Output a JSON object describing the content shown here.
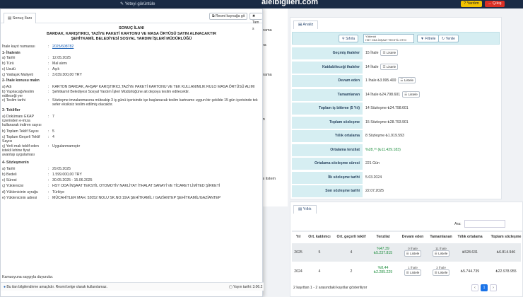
{
  "header": {
    "top_link": "Yeteyi görüntüle",
    "brand": "aleibiglieri.com",
    "help": "Yardım",
    "logout": "Çıkış"
  },
  "sidebar": {
    "items": [
      "",
      "arama",
      "ma",
      "",
      "arama",
      "",
      "",
      "im",
      "",
      "",
      "",
      "lis listem",
      "r"
    ]
  },
  "modal": {
    "tab": "Sonuç İlanı",
    "btn_source": "Resmi kaynağa git",
    "btn_other": "Tam s",
    "title_lines": [
      "SONUÇ İLANI",
      "BARDAK, KARIŞTIRICI, TAZİYE PAKETİ KARTONU VE MASA ÖRTÜSÜ SATIN ALINACAKTIR",
      "ŞEHİTKAMİL BELEDİYESİ SOSYAL YARDIM İŞLERİ MÜDÜRLÜĞÜ"
    ],
    "rows": [
      {
        "k": "İhale kayıt numarası",
        "v": "2025/608782",
        "link": true
      },
      {
        "k": "1- İhalenin",
        "sec": true
      },
      {
        "k": "a) Tarihi",
        "v": "12.05.2025"
      },
      {
        "k": "b) Türü",
        "v": "Mal alımı"
      },
      {
        "k": "c) Usulü",
        "v": "Açık"
      },
      {
        "k": "ç) Yaklaşık Maliyeti",
        "v": "3.039.300,00 TRY"
      },
      {
        "k": "2- İhale konusu malın",
        "sec": true
      },
      {
        "k": "a) Adı",
        "v": "KARTON BARDAK, AHŞAP KARIŞTIRICI,TAZİYE PAKETİ KARTONU VE TEK KULLANIMLIK RULO MASA ÖRTÜSÜ ALIMI"
      },
      {
        "k": "b) Yapılacağı/teslim edileceği yer",
        "v": "Şehitkamil Belediyesi Sosyal Yardım İşleri Müdürlüğüne ait depoya teslim edilecektir."
      },
      {
        "k": "c) Teslim tarihi",
        "v": "Sözleşme imzalanmasına müteakip 3 iş günü içerisinde işe başlanacak teslim kartname uygun bir şekilde 15 gün içerisinde tek sefer eksiksiz teslim edilmiş olacaktır."
      },
      {
        "k": "3- Teklifler",
        "sec": true
      },
      {
        "k": "a) Dokümanı EKAP üzerinden e-imza kullanarak indiren sayısı",
        "v": "7"
      },
      {
        "k": "b) Toplam Teklif Sayısı",
        "v": "5"
      },
      {
        "k": "c) Toplam Geçerli Teklif Sayısı",
        "v": "4"
      },
      {
        "k": "ç) Yerli malı teklif eden istekli lehine fiyat avantajı uygulaması",
        "v": "Uygulanmamıştır"
      },
      {
        "k": "4- Sözleşmenin",
        "sec": true
      },
      {
        "k": "a) Tarihi",
        "v": "29.05.2025"
      },
      {
        "k": "b) Bedeli",
        "v": "1.599.000,00 TRY"
      },
      {
        "k": "c) Süresi",
        "v": "30.05.2025 - 15.06.2025"
      },
      {
        "k": "ç) Yüklenicisi",
        "v": "HSY ODA İNŞAAT TEKSTİL OTOMOTİV NAKLİYAT İTHALAT SANAYİ VE TİCARET LİMİTED ŞİRKETİ"
      },
      {
        "k": "d) Yüklenicinin uyruğu",
        "v": "Türkiye"
      },
      {
        "k": "e) Yüklenicinin adresi",
        "v": "MÜCAHİTLER MAH. 52052 NOLU SK.NO:19/A ŞEHİTKAMİL / GAZİANTEP ŞEHİTKAMİL/GAZİANTEP"
      }
    ],
    "closing": "Kamuoyuna saygıyla duyurulur.",
    "footer_note": "Bu ilan bilgilendirme amaçlıdır. Resmi belge olarak kullanılamaz.",
    "footer_date": "Yayın tarihi: 3.06.2"
  },
  "analysis": {
    "tab": "Analiz",
    "btn_search": "Sıfırla",
    "tag_label": "Yüklenici",
    "tag_value": "HSY ODA İNŞAAT TEKSTİL OTOI",
    "btn_filter": "Filtrele",
    "btn_refresh": "Yenile",
    "list_label": "Listele",
    "stats": [
      {
        "label": "Geçmiş ihaleler",
        "value": "15 İhale",
        "btn": true
      },
      {
        "label": "Katılabileceği ihaleler",
        "value": "14 İhale",
        "btn": true
      },
      {
        "label": "Devam eden",
        "value": "1 İhale  ₺3.995.400",
        "btn": true
      },
      {
        "label": "Tamamlanan",
        "value": "14 İhale  ₺24.798.601",
        "btn": true
      },
      {
        "label": "Toplam iş bitirme (5 Yıl)",
        "value": "14 Sözleşme  ₺24.798.601",
        "btn": false
      },
      {
        "label": "Toplam sözleşme",
        "value": "15 Sözleşme  ₺28.793.901",
        "btn": false
      },
      {
        "label": "Yıllık ortalama",
        "value": "8 Sözleşme  ₺1.919.593",
        "btn": false
      },
      {
        "label": "Ortalama tenzilat",
        "value": "%28,⁵⁶  (₺11.429.183)",
        "btn": false,
        "green": true
      },
      {
        "label": "Ortalama sözleşme süresi",
        "value": "221 Gün",
        "btn": false
      },
      {
        "label": "İlk sözleşme tarihi",
        "value": "5.03.2024",
        "btn": false
      },
      {
        "label": "Son sözleşme tarihi",
        "value": "22.07.2025",
        "btn": false
      }
    ]
  },
  "yearly": {
    "tab": "Yıllık",
    "search_label": "Ara:",
    "columns": [
      "Yıl",
      "Ort. katılımcı",
      "Ort. geçerli teklif",
      "Tenzilat",
      "Devam eden",
      "Tamamlanan",
      "Yıllık ortalama",
      "Toplam sözleşme"
    ],
    "rows": [
      {
        "year": "2025",
        "part": "5",
        "valid": "4",
        "ten_pct": "%47,39",
        "ten_amt": "₺5.237.815",
        "cont": "0 İhale",
        "done": "11 İhale",
        "avg": "₺528.631",
        "total": "₺6.814.946"
      },
      {
        "year": "2024",
        "part": "4",
        "valid": "2",
        "ten_pct": "%8,44",
        "ten_amt": "₺2.285.229",
        "cont": "1 İhale",
        "done": "3 İhale",
        "avg": "₺5.744.739",
        "total": "₺22.978.955"
      }
    ],
    "info": "2 kayıttan 1 - 2 arasındaki kayıtlar gösteriliyor",
    "page": "1"
  }
}
